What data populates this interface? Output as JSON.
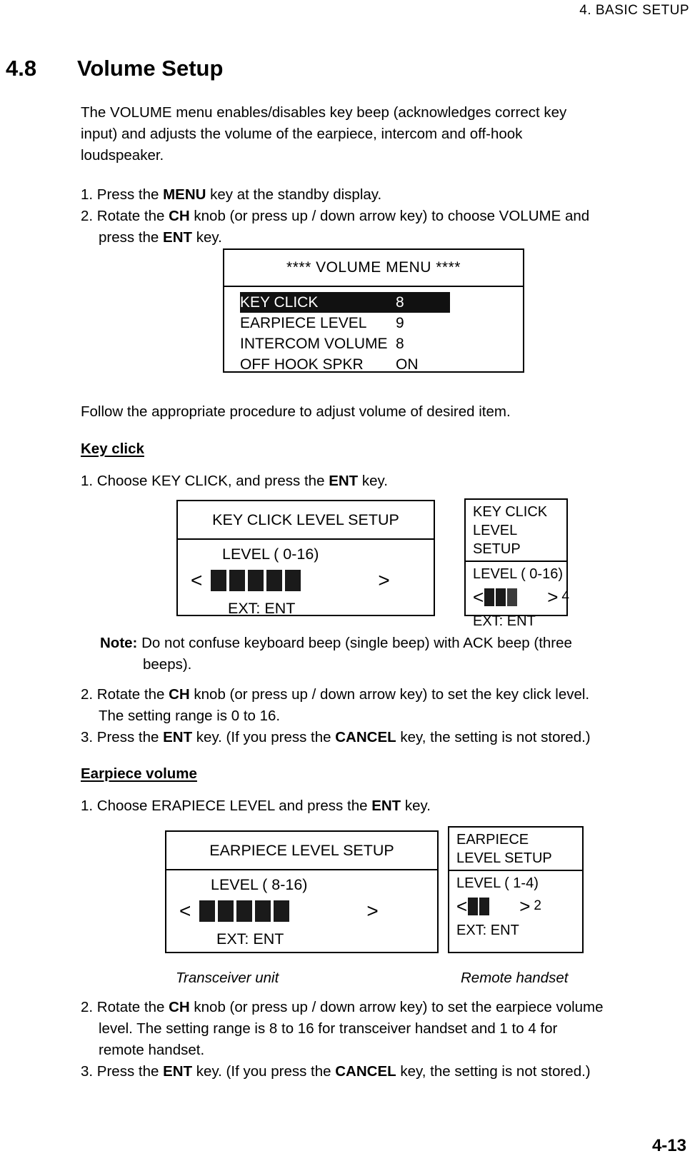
{
  "header": {
    "running_head": "4.  BASIC  SETUP"
  },
  "section": {
    "number": "4.8",
    "title": "Volume Setup"
  },
  "intro": {
    "line1": "The VOLUME menu enables/disables key beep (acknowledges correct key",
    "line2": "input) and adjusts the volume of the earpiece, intercom and off-hook",
    "line3": "loudspeaker."
  },
  "steps_top": {
    "s1_a": "1. Press the ",
    "s1_b": "MENU",
    "s1_c": " key at the standby display.",
    "s2_a": "2. Rotate the ",
    "s2_b": "CH",
    "s2_c": " knob (or press up / down arrow key) to choose VOLUME and",
    "s2_d": "press the ",
    "s2_e": "ENT",
    "s2_f": " key."
  },
  "volume_menu": {
    "title": "**** VOLUME MENU ****",
    "rows": [
      {
        "label": "KEY CLICK",
        "value": "8",
        "selected": true
      },
      {
        "label": "EARPIECE LEVEL",
        "value": "9",
        "selected": false
      },
      {
        "label": "INTERCOM VOLUME",
        "value": "8",
        "selected": false
      },
      {
        "label": "OFF HOOK SPKR",
        "value": "ON",
        "selected": false
      }
    ]
  },
  "follow_text": "Follow the appropriate procedure to adjust volume of desired item.",
  "key_click": {
    "heading": "Key click",
    "lead_a": "1. Choose KEY CLICK, and press the ",
    "lead_b": "ENT",
    "lead_c": " key.",
    "transceiver": {
      "title": "KEY CLICK LEVEL SETUP",
      "range": "LEVEL  (  0-16)",
      "arrow_left": "<",
      "arrow_right": ">",
      "bars": 5,
      "value": "",
      "exit": "EXT: ENT"
    },
    "remote": {
      "title_line1": "KEY CLICK",
      "title_line2": "LEVEL SETUP",
      "range": "LEVEL  (  0-16)",
      "arrow_left": "<",
      "arrow_right": ">",
      "bars": 3,
      "value": "4",
      "exit": "EXT: ENT"
    },
    "note": {
      "label": "Note:",
      "line1": " Do not confuse keyboard beep (single beep) with ACK beep (three",
      "line2": "beeps)."
    },
    "step2_a": "2. Rotate the ",
    "step2_b": "CH",
    "step2_c": " knob (or press up / down arrow key) to set the key click level.",
    "step2_d": "The setting range is 0 to 16.",
    "step3_a": "3. Press the ",
    "step3_b": "ENT",
    "step3_c": " key. (If you press the ",
    "step3_d": "CANCEL",
    "step3_e": " key, the setting is not stored.)"
  },
  "earpiece": {
    "heading": "Earpiece volume",
    "lead_a": "1. Choose ERAPIECE LEVEL and press the ",
    "lead_b": "ENT",
    "lead_c": " key.",
    "transceiver": {
      "title": "EARPIECE LEVEL SETUP",
      "range": "LEVEL  (  8-16)",
      "arrow_left": "<",
      "arrow_right": ">",
      "bars": 5,
      "value": "",
      "exit": "EXT: ENT"
    },
    "remote": {
      "title_line1": "EARPIECE",
      "title_line2": "LEVEL SETUP",
      "range": "LEVEL  (  1-4)",
      "arrow_left": "<",
      "arrow_right": ">",
      "bars": 2,
      "value": "2",
      "exit": "EXT: ENT"
    },
    "caption_left": "Transceiver unit",
    "caption_right": "Remote handset",
    "step2_a": "2. Rotate the ",
    "step2_b": "CH",
    "step2_c": " knob (or press up / down arrow key) to set the earpiece volume",
    "step2_d": "level. The setting range is 8 to 16 for transceiver handset and 1 to 4 for",
    "step2_e": "remote handset.",
    "step3_a": "3. Press the ",
    "step3_b": "ENT",
    "step3_c": " key. (If you press the ",
    "step3_d": "CANCEL",
    "step3_e": " key, the setting is not stored.)"
  },
  "footer": {
    "page_number": "4-13"
  }
}
